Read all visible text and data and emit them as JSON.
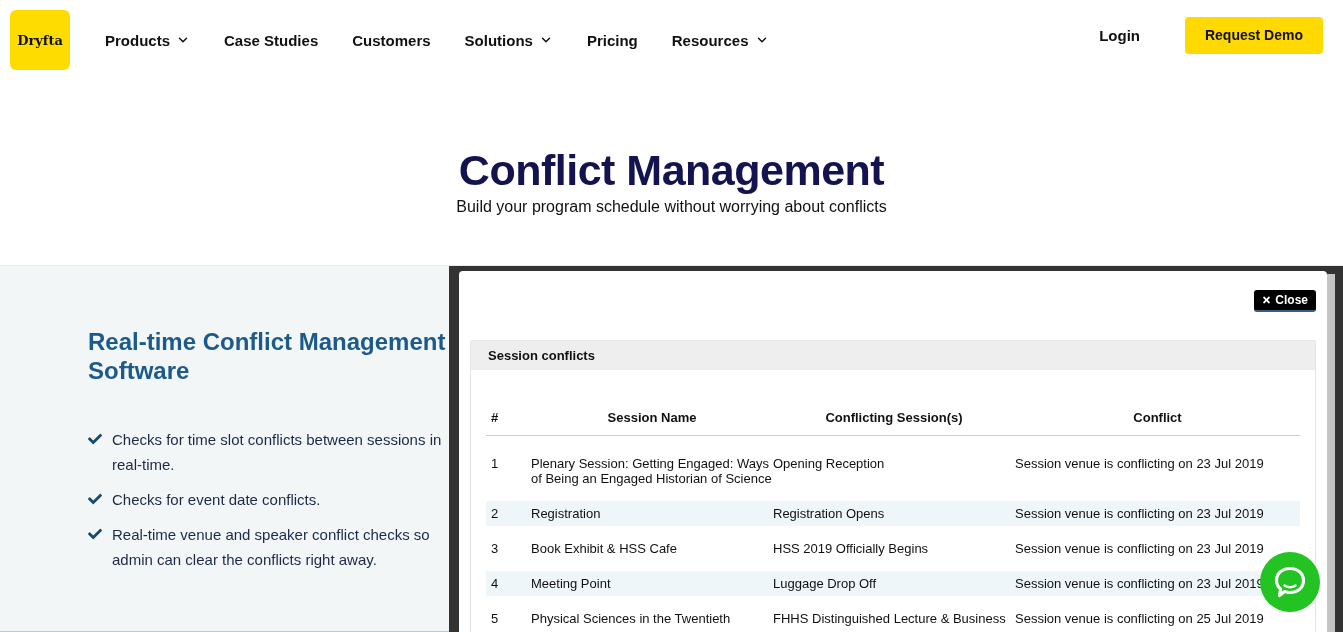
{
  "header": {
    "logo": "Dryfta",
    "nav": [
      {
        "label": "Products",
        "has_menu": true
      },
      {
        "label": "Case Studies",
        "has_menu": false
      },
      {
        "label": "Customers",
        "has_menu": false
      },
      {
        "label": "Solutions",
        "has_menu": true
      },
      {
        "label": "Pricing",
        "has_menu": false
      },
      {
        "label": "Resources",
        "has_menu": true
      }
    ],
    "login": "Login",
    "cta": "Request Demo"
  },
  "hero": {
    "title": "Conflict Management",
    "subtitle": "Build your program schedule without worrying about conflicts"
  },
  "feature": {
    "heading": "Real-time Conflict Management Software",
    "bullets": [
      "Checks for time slot conflicts between sessions in real-time.",
      "Checks for event date conflicts.",
      "Real-time venue and speaker conflict checks so admin can clear the conflicts right away."
    ]
  },
  "screenshot": {
    "close_button": "Close",
    "panel_title": "Session conflicts",
    "table": {
      "columns": [
        "#",
        "Session Name",
        "Conflicting Session(s)",
        "Conflict"
      ],
      "rows": [
        [
          "1",
          "Plenary Session: Getting Engaged: Ways of Being an Engaged Historian of Science",
          "Opening Reception",
          "Session venue is conflicting on 23 Jul 2019"
        ],
        [
          "2",
          "Registration",
          "Registration Opens",
          "Session venue is conflicting on 23 Jul 2019"
        ],
        [
          "3",
          "Book Exhibit & HSS Cafe",
          "HSS 2019 Officially Begins",
          "Session venue is conflicting on 23 Jul 2019"
        ],
        [
          "4",
          "Meeting Point",
          "Luggage Drop Off",
          "Session venue is conflicting on 23 Jul 2019"
        ],
        [
          "5",
          "Physical Sciences in the Twentieth",
          "FHHS Distinguished Lecture & Business",
          "Session venue is conflicting on 25 Jul 2019"
        ]
      ]
    }
  }
}
